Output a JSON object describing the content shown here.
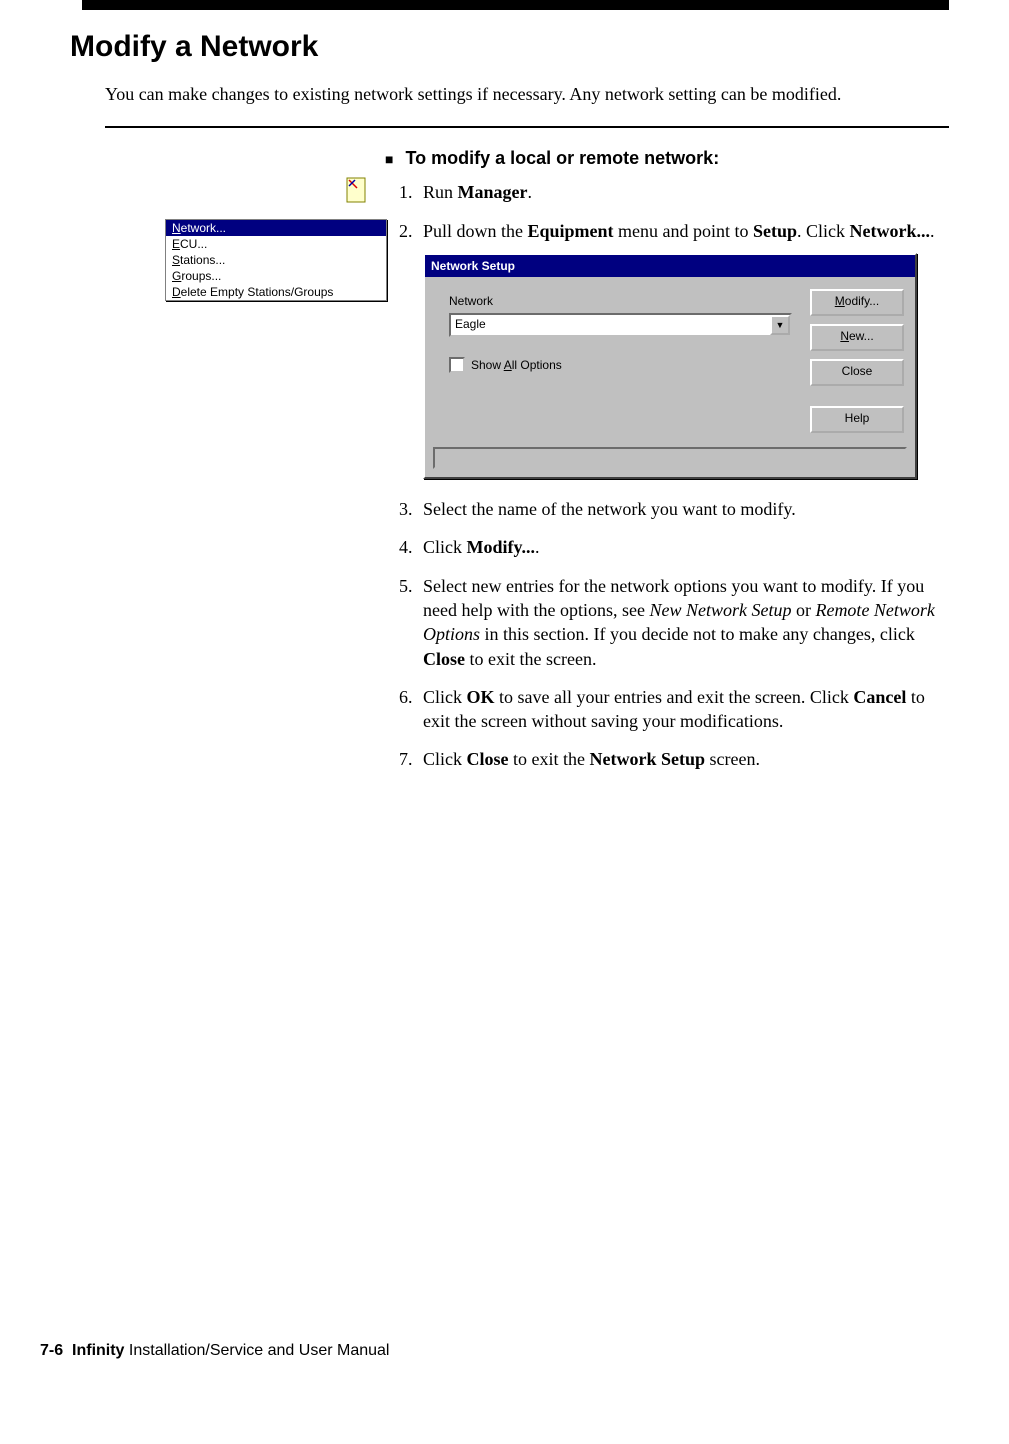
{
  "heading": "Modify a Network",
  "intro": "You can make changes to existing network settings if necessary. Any network setting can be modified.",
  "menu": {
    "items": [
      "Network...",
      "ECU...",
      "Stations...",
      "Groups...",
      "Delete Empty Stations/Groups"
    ],
    "selected_index": 0
  },
  "procedure": {
    "title": "To modify a local or remote network:",
    "steps": [
      {
        "text_before": "Run ",
        "bold1": "Manager",
        "text_after": "."
      },
      {
        "text_before": "Pull down the ",
        "bold1": "Equipment",
        "mid1": " menu and point to ",
        "bold2": "Setup",
        "mid2": ". Click ",
        "bold3": "Network...",
        "text_after": "."
      },
      {
        "text_before": "Select the name of the network you want to modify."
      },
      {
        "text_before": "Click ",
        "bold1": "Modify...",
        "text_after": "."
      },
      {
        "text_before": "Select new entries for the network options you want to modify. If you need help with the options, see ",
        "ital1": "New Network Setup",
        "mid1": " or ",
        "ital2": "Remote Network Options",
        "mid2": " in this section. If you decide not to make any changes, click ",
        "bold1": "Close",
        "text_after": " to exit the screen."
      },
      {
        "text_before": "Click ",
        "bold1": "OK",
        "mid1": " to save all your entries and exit the screen. Click ",
        "bold2": "Cancel",
        "text_after": " to exit the screen without saving your modifications."
      },
      {
        "text_before": "Click ",
        "bold1": "Close",
        "mid1": " to exit the ",
        "bold2": "Network Setup",
        "text_after": " screen."
      }
    ]
  },
  "dialog": {
    "title": "Network Setup",
    "network_label": "Network",
    "network_value": "Eagle",
    "show_all_label": "Show All Options",
    "buttons": {
      "modify": "Modify...",
      "new": "New...",
      "close": "Close",
      "help": "Help"
    }
  },
  "footer": {
    "page": "7-6",
    "title_bold": "Infinity",
    "title_rest": " Installation/Service and User Manual"
  }
}
